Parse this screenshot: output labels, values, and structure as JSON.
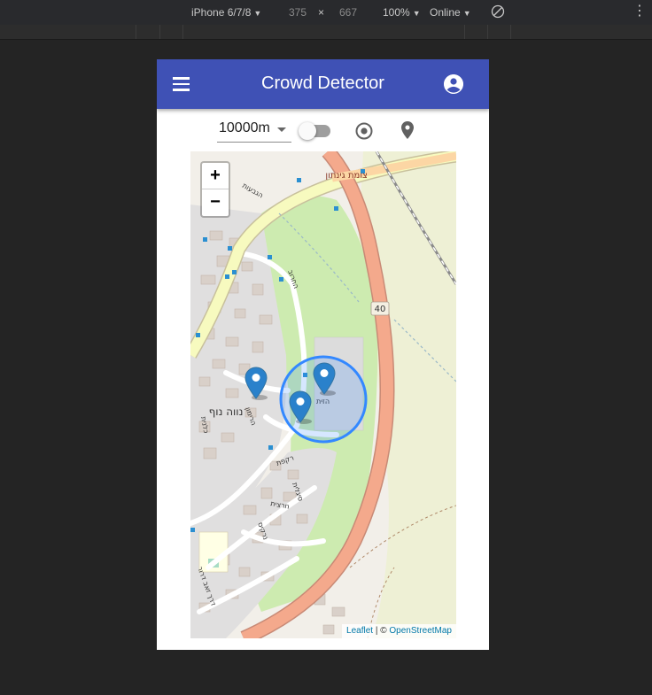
{
  "devtools": {
    "device": "iPhone 6/7/8",
    "width": "375",
    "times": "×",
    "height": "667",
    "zoom": "100%",
    "network": "Online",
    "more": "⋮"
  },
  "app": {
    "title": "Crowd Detector",
    "primary_color": "#3f51b5",
    "menu_icon": "menu-icon",
    "account_icon": "account-circle-icon"
  },
  "controls": {
    "radius_value": "10000m",
    "toggle_on": false,
    "locate_icon": "my-location-icon",
    "pin_icon": "place-icon"
  },
  "map": {
    "zoom_in": "+",
    "zoom_out": "−",
    "attribution_leaflet": "Leaflet",
    "attribution_sep": " | © ",
    "attribution_osm": "OpenStreetMap",
    "markers": 3,
    "labels": {
      "junction": "צומת גינתון",
      "neighborhood": "נווה נוף",
      "road_number": "40",
      "street_hagiv": "הגבעות",
      "street_kalanit": "כלנית",
      "street_harimon": "הרימון",
      "street_haharuv": "החרוב",
      "street_rakefet": "רקפת",
      "street_sigalit": "סיגלית",
      "street_hazit": "הזית",
      "street_hartsit": "חרצית",
      "street_narkis": "נרקיס",
      "street_dror": "דרך זאב דרור"
    }
  }
}
